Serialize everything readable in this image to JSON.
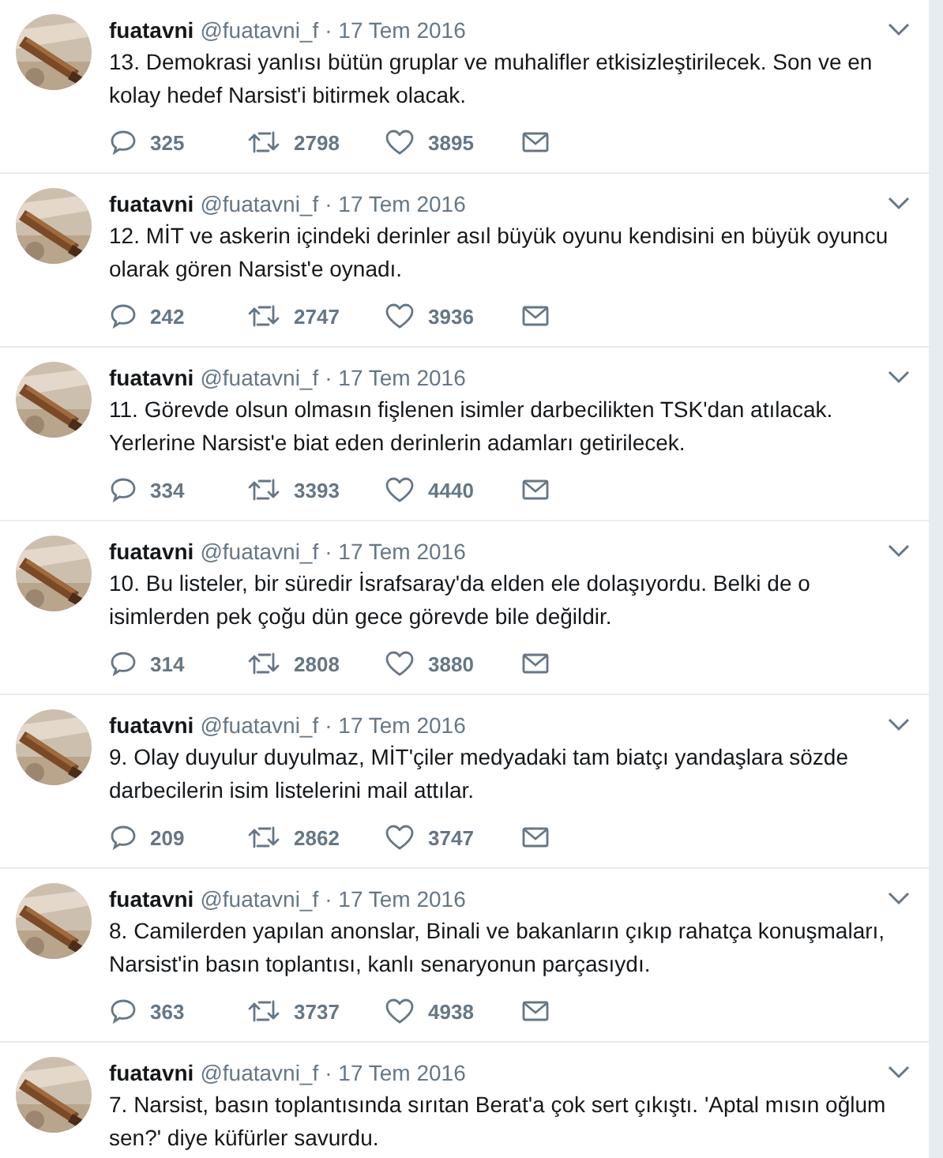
{
  "tweets": [
    {
      "name": "fuatavni",
      "handle": "@fuatavni_f",
      "date": "· 17 Tem 2016",
      "text": "13. Demokrasi yanlısı bütün gruplar ve muhalifler etkisizleştirilecek. Son ve en kolay hedef Narsist'i bitirmek olacak.",
      "actions": {
        "replies": "325",
        "retweets": "2798",
        "likes": "3895"
      }
    },
    {
      "name": "fuatavni",
      "handle": "@fuatavni_f",
      "date": "· 17 Tem 2016",
      "text": "12. MİT ve askerin içindeki derinler asıl büyük oyunu kendisini en büyük oyuncu olarak gören Narsist'e oynadı.",
      "actions": {
        "replies": "242",
        "retweets": "2747",
        "likes": "3936"
      }
    },
    {
      "name": "fuatavni",
      "handle": "@fuatavni_f",
      "date": "· 17 Tem 2016",
      "text": "11. Görevde olsun olmasın fişlenen isimler darbecilikten TSK'dan atılacak. Yerlerine Narsist'e biat eden derinlerin adamları getirilecek.",
      "actions": {
        "replies": "334",
        "retweets": "3393",
        "likes": "4440"
      }
    },
    {
      "name": "fuatavni",
      "handle": "@fuatavni_f",
      "date": "· 17 Tem 2016",
      "text": "10. Bu listeler, bir süredir İsrafsaray'da elden ele dolaşıyordu. Belki de o isimlerden pek çoğu dün gece görevde bile değildir.",
      "actions": {
        "replies": "314",
        "retweets": "2808",
        "likes": "3880"
      }
    },
    {
      "name": "fuatavni",
      "handle": "@fuatavni_f",
      "date": "· 17 Tem 2016",
      "text": "9. Olay duyulur duyulmaz, MİT'çiler medyadaki tam biatçı yandaşlara sözde darbecilerin isim listelerini mail attılar.",
      "actions": {
        "replies": "209",
        "retweets": "2862",
        "likes": "3747"
      }
    },
    {
      "name": "fuatavni",
      "handle": "@fuatavni_f",
      "date": "· 17 Tem 2016",
      "text": "8. Camilerden yapılan anonslar, Binali ve bakanların çıkıp rahatça konuşmaları, Narsist'in basın toplantısı, kanlı senaryonun parçasıydı.",
      "actions": {
        "replies": "363",
        "retweets": "3737",
        "likes": "4938"
      }
    },
    {
      "name": "fuatavni",
      "handle": "@fuatavni_f",
      "date": "· 17 Tem 2016",
      "text": "7. Narsist, basın toplantısında sırıtan Berat'a çok sert çıkıştı. 'Aptal mısın oğlum sen?' diye küfürler savurdu."
    }
  ]
}
